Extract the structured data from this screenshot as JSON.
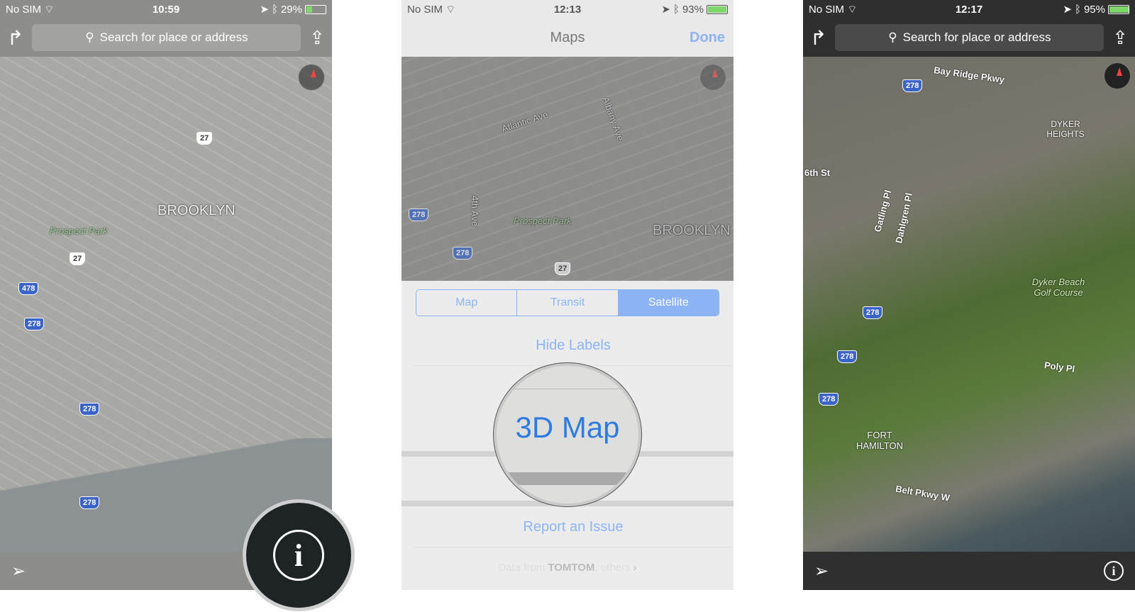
{
  "panels": [
    {
      "status": {
        "carrier": "No SIM",
        "time": "10:59",
        "battery": "29%",
        "battery_level": 0.29
      },
      "search_placeholder": "Search for place or address",
      "map_labels": [
        "BROOKLYN",
        "Prospect Park"
      ],
      "route_shields": [
        "27",
        "27",
        "478",
        "278",
        "278",
        "278"
      ]
    },
    {
      "status": {
        "carrier": "No SIM",
        "time": "12:13",
        "battery": "93%",
        "battery_level": 0.93
      },
      "title": "Maps",
      "done": "Done",
      "map_labels": [
        "Atlantic Ave",
        "Albany Ave",
        "4th Ave",
        "Prospect Park",
        "BROOKLYN"
      ],
      "route_shields": [
        "278",
        "278",
        "27"
      ],
      "segments": [
        "Map",
        "Transit",
        "Satellite"
      ],
      "selected_segment": "Satellite",
      "hide_labels": "Hide Labels",
      "map_3d": "3D Map",
      "report": "Report an Issue",
      "attribution": {
        "prefix": "Data from",
        "brand": "TOMTOM",
        "suffix": ", others"
      }
    },
    {
      "status": {
        "carrier": "No SIM",
        "time": "12:17",
        "battery": "95%",
        "battery_level": 0.95
      },
      "search_placeholder": "Search for place or address",
      "map_labels": [
        "Bay Ridge Pkwy",
        "DYKER HEIGHTS",
        "6th St",
        "Gatling Pl",
        "Dahlgren Pl",
        "Dyker Beach Golf Course",
        "Poly Pl",
        "FORT HAMILTON",
        "Belt Pkwy W"
      ],
      "route_shields": [
        "278",
        "278",
        "278",
        "278"
      ]
    }
  ],
  "colors": {
    "accent": "#2f7be0",
    "segment_selected": "#8cb3f3"
  }
}
